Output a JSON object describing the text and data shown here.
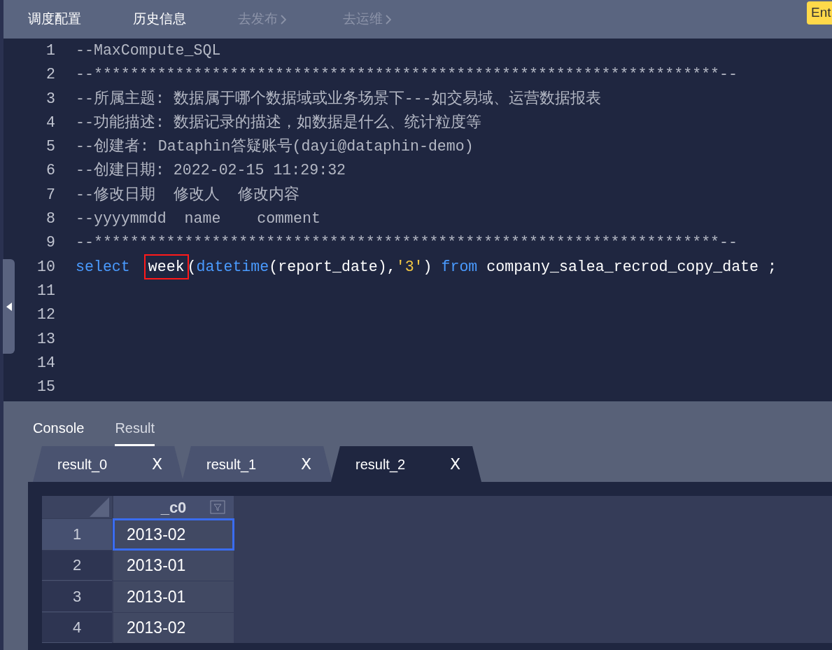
{
  "top_tabs": [
    {
      "label": "调度配置",
      "disabled": false,
      "arrow": false
    },
    {
      "label": "历史信息",
      "disabled": false,
      "arrow": false
    },
    {
      "label": "去发布",
      "disabled": true,
      "arrow": true
    },
    {
      "label": "去运维",
      "disabled": true,
      "arrow": true
    }
  ],
  "tooltip": "Ent",
  "editor": {
    "lines": [
      {
        "number": "1",
        "tokens": [
          {
            "kind": "comment",
            "text": "--MaxCompute_SQL"
          }
        ]
      },
      {
        "number": "2",
        "tokens": [
          {
            "kind": "comment",
            "text": "--*********************************************************************--"
          }
        ]
      },
      {
        "number": "3",
        "tokens": [
          {
            "kind": "comment",
            "text": "--所属主题: 数据属于哪个数据域或业务场景下---如交易域、运营数据报表"
          }
        ]
      },
      {
        "number": "4",
        "tokens": [
          {
            "kind": "comment",
            "text": "--功能描述: 数据记录的描述，如数据是什么、统计粒度等"
          }
        ]
      },
      {
        "number": "5",
        "tokens": [
          {
            "kind": "comment",
            "text": "--创建者: Dataphin答疑账号(dayi@dataphin-demo)"
          }
        ]
      },
      {
        "number": "6",
        "tokens": [
          {
            "kind": "comment",
            "text": "--创建日期: 2022-02-15 11:29:32"
          }
        ]
      },
      {
        "number": "7",
        "tokens": [
          {
            "kind": "comment",
            "text": "--修改日期  修改人  修改内容"
          }
        ]
      },
      {
        "number": "8",
        "tokens": [
          {
            "kind": "comment",
            "text": "--yyyymmdd  name    comment"
          }
        ]
      },
      {
        "number": "9",
        "tokens": [
          {
            "kind": "comment",
            "text": "--*********************************************************************--"
          }
        ]
      },
      {
        "number": "10",
        "tokens": [
          {
            "kind": "keyword",
            "text": "select"
          },
          {
            "kind": "highlight",
            "text": "week"
          },
          {
            "kind": "plain",
            "text": "("
          },
          {
            "kind": "keyword",
            "text": "datetime"
          },
          {
            "kind": "plain",
            "text": "(report_date),"
          },
          {
            "kind": "string",
            "text": "'3'"
          },
          {
            "kind": "plain",
            "text": ") "
          },
          {
            "kind": "keyword",
            "text": "from"
          },
          {
            "kind": "plain",
            "text": " company_salea_recrod_copy_date ;"
          }
        ]
      },
      {
        "number": "11"
      },
      {
        "number": "12"
      },
      {
        "number": "13"
      },
      {
        "number": "14"
      },
      {
        "number": "15"
      }
    ]
  },
  "panel_tabs": [
    {
      "label": "Console",
      "selected": false
    },
    {
      "label": "Result",
      "selected": true
    }
  ],
  "result_tabs": [
    {
      "label": "result_0",
      "close": "X",
      "selected": false
    },
    {
      "label": "result_1",
      "close": "X",
      "selected": false
    },
    {
      "label": "result_2",
      "close": "X",
      "selected": true
    }
  ],
  "table": {
    "columns": [
      "_c0"
    ],
    "rows": [
      {
        "number": "1",
        "cells": [
          "2013-02"
        ],
        "selected": true
      },
      {
        "number": "2",
        "cells": [
          "2013-01"
        ],
        "selected": false
      },
      {
        "number": "3",
        "cells": [
          "2013-01"
        ],
        "selected": false
      },
      {
        "number": "4",
        "cells": [
          "2013-02"
        ],
        "selected": false
      }
    ]
  }
}
